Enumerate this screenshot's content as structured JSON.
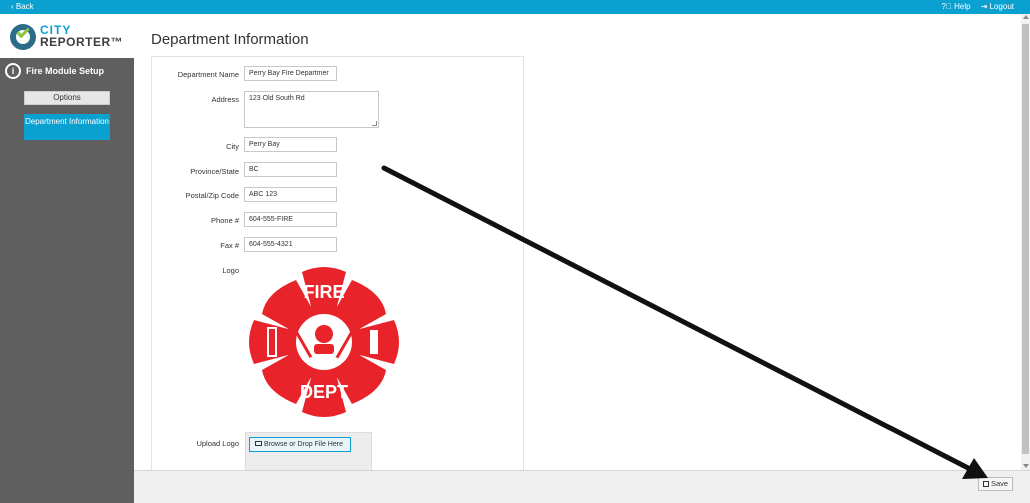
{
  "topbar": {
    "back_label": "‹ Back",
    "help_label": "Help",
    "logout_label": "Logout",
    "accent_color": "#0aa0d0"
  },
  "sidebar": {
    "logo_line1": "CITY",
    "logo_line2": "REPORTER™",
    "module_title": "Fire Module Setup",
    "items": [
      {
        "label": "Options",
        "active": false
      },
      {
        "label": "Department Information",
        "active": true
      }
    ]
  },
  "main": {
    "title": "Department Information",
    "fields": {
      "name": {
        "label": "Department Name",
        "value": "Perry Bay Fire Departmer"
      },
      "address": {
        "label": "Address",
        "value": "123 Old South Rd"
      },
      "city": {
        "label": "City",
        "value": "Perry Bay"
      },
      "province": {
        "label": "Province/State",
        "value": "BC"
      },
      "postal": {
        "label": "Postal/Zip Code",
        "value": "ABC 123"
      },
      "phone": {
        "label": "Phone #",
        "value": "604-555-FIRE"
      },
      "fax": {
        "label": "Fax #",
        "value": "604-555-4321"
      },
      "logo": {
        "label": "Logo",
        "badge_top": "FIRE",
        "badge_bottom": "DEPT"
      },
      "upload": {
        "label": "Upload Logo",
        "button": "Browse or Drop File Here"
      }
    }
  },
  "footer": {
    "save_label": "Save"
  },
  "icons": {
    "help": "help-icon",
    "logout": "logout-icon",
    "module": "fire-extinguisher-icon",
    "folder": "folder-icon",
    "save": "floppy-disk-icon"
  }
}
